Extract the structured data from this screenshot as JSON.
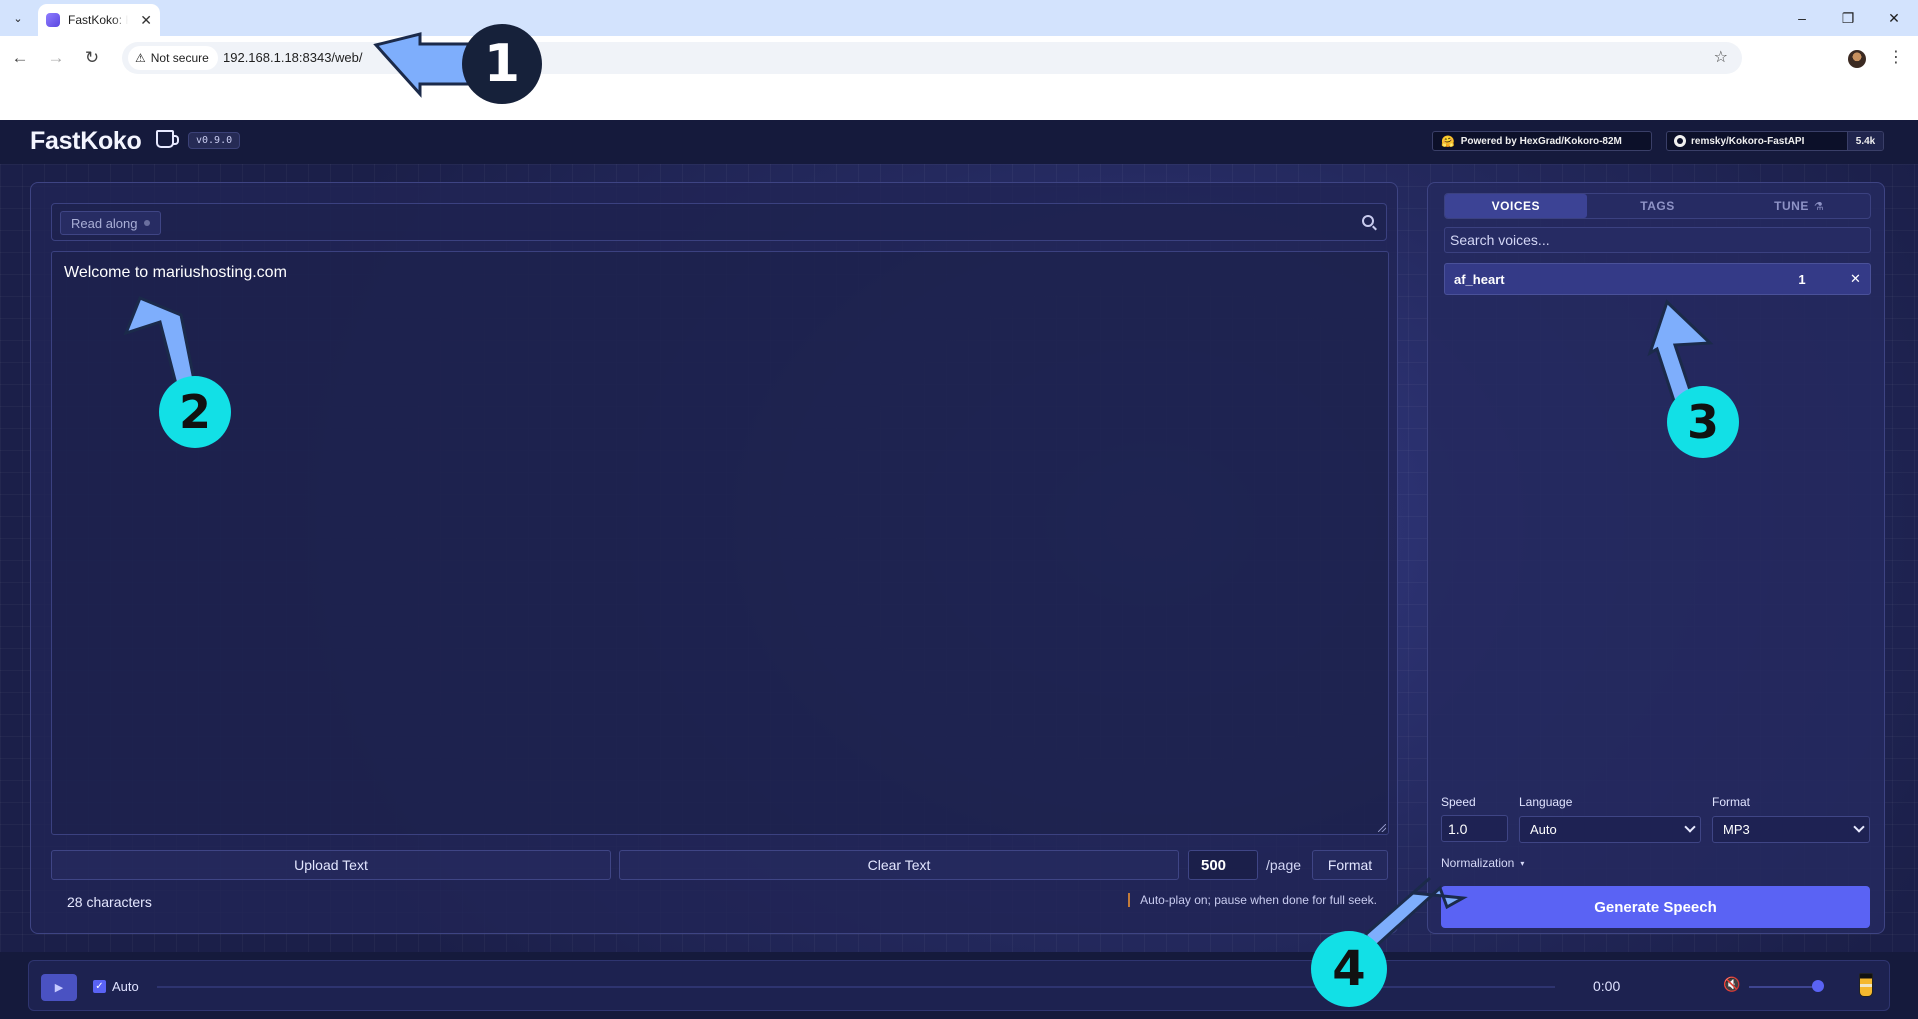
{
  "browser": {
    "tab_title": "FastKoko: K",
    "security_label": "Not secure",
    "url": "192.168.1.18:8343/web/"
  },
  "header": {
    "brand": "FastKoko",
    "version": "v0.9.0",
    "powered_badge": "Powered by HexGrad/Kokoro-82M",
    "github_repo": "remsky/Kokoro-FastAPI",
    "github_stars": "5.4k"
  },
  "editor": {
    "read_along_label": "Read along",
    "text": "Welcome to mariushosting.com",
    "upload_label": "Upload Text",
    "clear_label": "Clear Text",
    "chars_per_page": "500",
    "per_page_label": "/page",
    "format_label": "Format",
    "char_count": "28 characters",
    "autoplay_note": "Auto-play on; pause when done for full seek."
  },
  "voices": {
    "tabs": [
      {
        "label": "VOICES",
        "active": true
      },
      {
        "label": "TAGS",
        "active": false
      },
      {
        "label": "TUNE",
        "active": false
      }
    ],
    "search_placeholder": "Search voices...",
    "selected": [
      {
        "name": "af_heart",
        "weight": "1"
      }
    ],
    "speed_label": "Speed",
    "speed_value": "1.0",
    "language_label": "Language",
    "language_value": "Auto",
    "format_label": "Format",
    "format_value": "MP3",
    "normalization_label": "Normalization",
    "generate_label": "Generate Speech"
  },
  "player": {
    "auto_label": "Auto",
    "auto_checked": true,
    "time": "0:00",
    "volume_fraction": 0.95
  },
  "annotations": [
    "1",
    "2",
    "3",
    "4"
  ],
  "colors": {
    "accent": "#5a63f4",
    "annotation_dark": "#16213a",
    "annotation_cyan": "#12e0e6",
    "arrow_blue": "#7eaefc"
  }
}
